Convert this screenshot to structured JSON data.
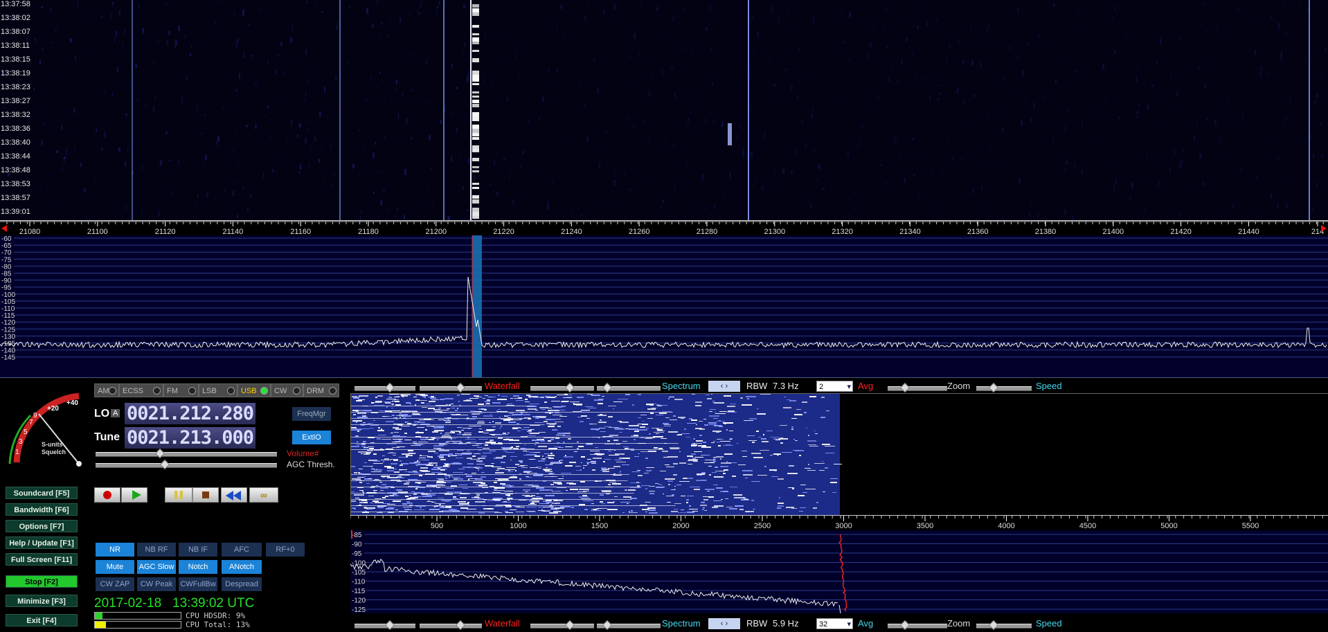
{
  "timestamps": [
    "13:37:58",
    "13:38:02",
    "13:38:07",
    "13:38:11",
    "13:38:15",
    "13:38:19",
    "13:38:23",
    "13:38:27",
    "13:38:32",
    "13:38:36",
    "13:38:40",
    "13:38:44",
    "13:38:48",
    "13:38:53",
    "13:38:57",
    "13:39:01"
  ],
  "freq_scale": [
    "21080",
    "21100",
    "21120",
    "21140",
    "21160",
    "21180",
    "21200",
    "21220",
    "21240",
    "21260",
    "21280",
    "21300",
    "21320",
    "21340",
    "21360",
    "21380",
    "21400",
    "21420",
    "21440",
    "214"
  ],
  "spectrum_db": [
    "-60",
    "-65",
    "-70",
    "-75",
    "-80",
    "-85",
    "-90",
    "-95",
    "-100",
    "-105",
    "-110",
    "-115",
    "-120",
    "-125",
    "-130",
    "-135",
    "-140",
    "-145"
  ],
  "modes": [
    {
      "label": "AM",
      "active": false
    },
    {
      "label": "ECSS",
      "active": false
    },
    {
      "label": "FM",
      "active": false
    },
    {
      "label": "LSB",
      "active": false
    },
    {
      "label": "USB",
      "active": true
    },
    {
      "label": "CW",
      "active": false
    },
    {
      "label": "DRM",
      "active": false
    }
  ],
  "smeter": {
    "plus40": "+40",
    "plus20": "+20",
    "s9": "9",
    "s7": "7",
    "s5": "5",
    "s3": "3",
    "s1": "1",
    "label1": "S-units",
    "label2": "Squelch"
  },
  "lo": {
    "label": "LO",
    "badge": "A",
    "value": "0021.212.280"
  },
  "tune": {
    "label": "Tune",
    "value": "0021.213.000"
  },
  "freqmgr": "FreqMgr",
  "extio": "ExtIO",
  "volume_label": "Volume#",
  "agc_label": "AGC Thresh.",
  "side_buttons": [
    "Soundcard [F5]",
    "Bandwidth [F6]",
    "Options [F7]",
    "Help / Update [F1]",
    "Full Screen [F11]",
    "Stop [F2]",
    "Minimize [F3]",
    "Exit [F4]"
  ],
  "dsp_row1": [
    "NR",
    "NB RF",
    "NB IF",
    "AFC",
    "RF+0"
  ],
  "dsp_row2": [
    "Mute",
    "AGC Slow",
    "Notch",
    "ANotch"
  ],
  "dsp_row3": [
    "CW ZAP",
    "CW Peak",
    "CWFullBw",
    "Despread"
  ],
  "datetime": "2017-02-18   13:39:02 UTC",
  "cpu_hdsdr": "CPU HDSDR: 9%",
  "cpu_total": "CPU Total: 13%",
  "top_controls": {
    "waterfall": "Waterfall",
    "spectrum": "Spectrum",
    "rbw_label": "RBW",
    "rbw": "7.3 Hz",
    "avg_value": "2",
    "avg": "Avg",
    "zoom": "Zoom",
    "speed": "Speed"
  },
  "bottom_controls": {
    "waterfall": "Waterfall",
    "spectrum": "Spectrum",
    "rbw_label": "RBW",
    "rbw": "5.9 Hz",
    "avg_value": "32",
    "avg": "Avg",
    "zoom": "Zoom",
    "speed": "Speed"
  },
  "af_scale": [
    "500",
    "1000",
    "1500",
    "2000",
    "2500",
    "3000",
    "3500",
    "4000",
    "4500",
    "5000",
    "5500"
  ],
  "af_db": [
    "-85",
    "-90",
    "-95",
    "-100",
    "-105",
    "-110",
    "-115",
    "-120",
    "-125"
  ],
  "colors": {
    "accent_blue": "#1b83d8",
    "active_green": "#22c82c",
    "waterfall_bg": "#020213",
    "label_cyan": "#43d8f0",
    "label_red": "#ff2020"
  }
}
